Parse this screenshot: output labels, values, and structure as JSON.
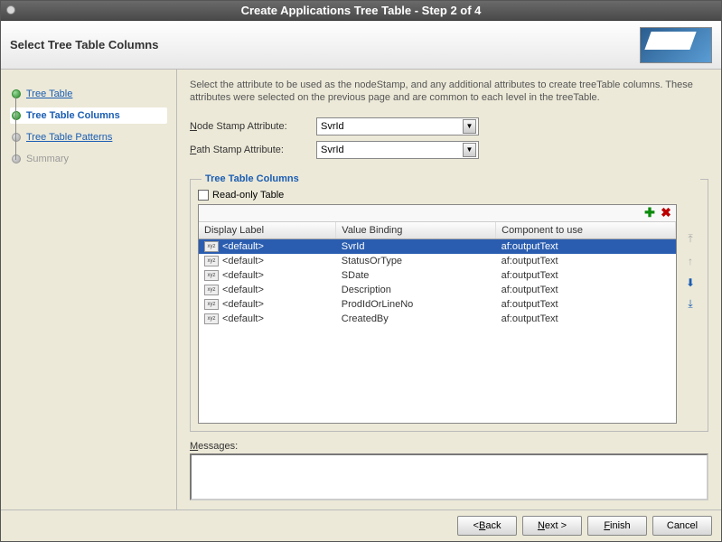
{
  "window": {
    "title": "Create Applications Tree Table - Step 2 of 4"
  },
  "header": {
    "title": "Select Tree Table Columns"
  },
  "sidebar": {
    "items": [
      {
        "label": "Tree Table"
      },
      {
        "label": "Tree Table Columns"
      },
      {
        "label": "Tree Table Patterns"
      },
      {
        "label": "Summary"
      }
    ]
  },
  "intro": "Select the attribute to be used as the nodeStamp, and any additional attributes to create treeTable columns.  These attributes were selected on the previous page and are common to each level in the treeTable.",
  "form": {
    "nodeStamp": {
      "label": "Node Stamp Attribute:",
      "value": "SvrId"
    },
    "pathStamp": {
      "label": "Path Stamp Attribute:",
      "value": "SvrId"
    }
  },
  "fieldset": {
    "title": "Tree Table Columns",
    "readonly_label": "Read-only Table",
    "readonly_checked": false,
    "columns": {
      "c0": "Display Label",
      "c1": "Value Binding",
      "c2": "Component to use"
    },
    "rows": [
      {
        "label": "<default>",
        "binding": "SvrId",
        "component": "af:outputText"
      },
      {
        "label": "<default>",
        "binding": "StatusOrType",
        "component": "af:outputText"
      },
      {
        "label": "<default>",
        "binding": "SDate",
        "component": "af:outputText"
      },
      {
        "label": "<default>",
        "binding": "Description",
        "component": "af:outputText"
      },
      {
        "label": "<default>",
        "binding": "ProdIdOrLineNo",
        "component": "af:outputText"
      },
      {
        "label": "<default>",
        "binding": "CreatedBy",
        "component": "af:outputText"
      }
    ]
  },
  "messages": {
    "label": "Messages:"
  },
  "footer": {
    "back": "< Back",
    "next": "Next >",
    "finish": "Finish",
    "cancel": "Cancel"
  }
}
